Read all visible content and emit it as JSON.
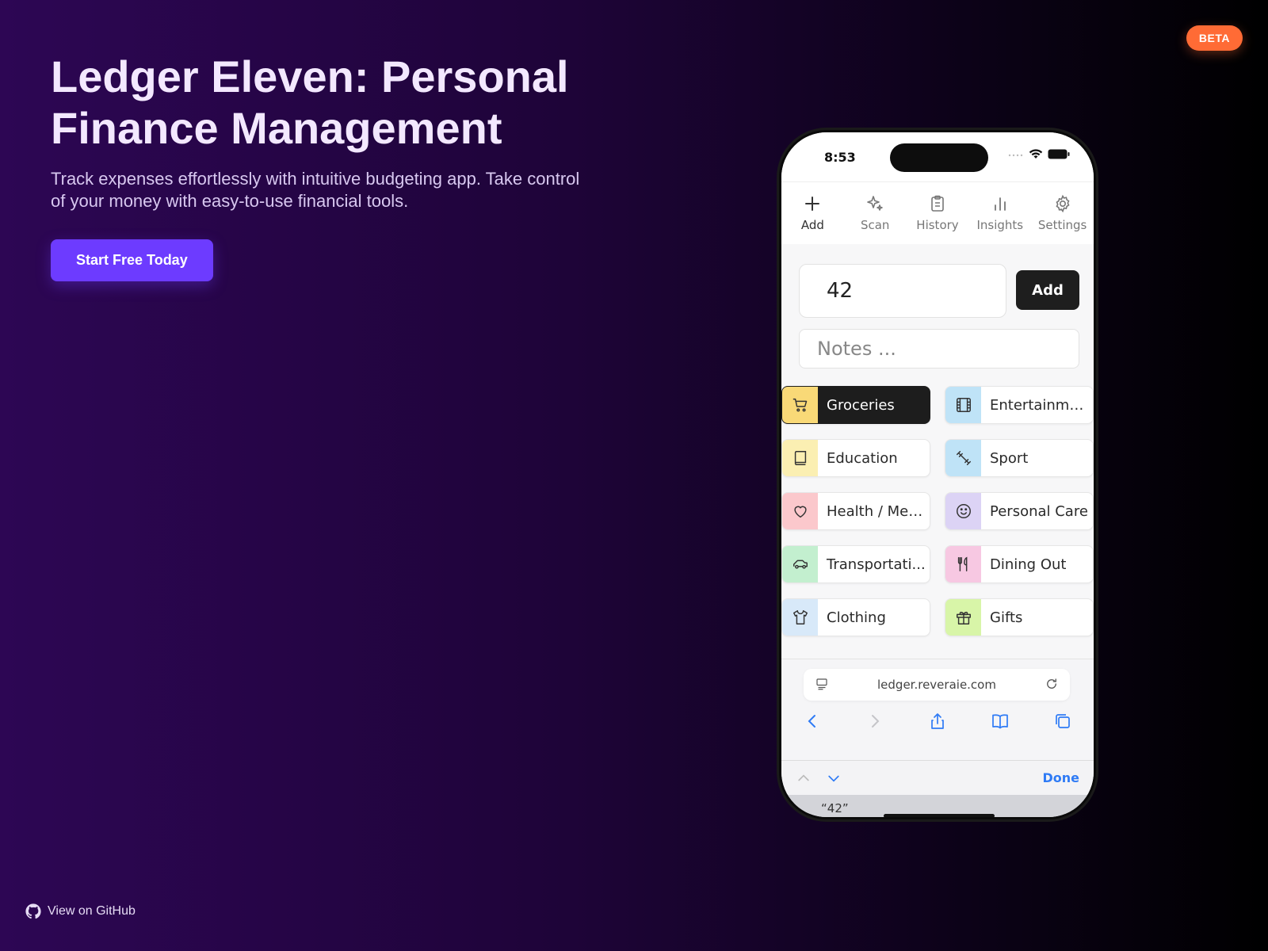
{
  "badge": "BETA",
  "hero": {
    "title": "Ledger Eleven: Personal Finance Management",
    "subtitle": "Track expenses effortlessly with intuitive budgeting app. Take control of your money with easy-to-use financial tools.",
    "cta_label": "Start Free Today"
  },
  "footer": {
    "github_label": "View on GitHub"
  },
  "colors": {
    "accent": "#6d3bff",
    "badge": "#ff6b35"
  },
  "phone": {
    "time": "8:53",
    "toolbar": [
      {
        "label": "Add",
        "icon": "plus-icon"
      },
      {
        "label": "Scan",
        "icon": "sparkle-icon"
      },
      {
        "label": "History",
        "icon": "clipboard-icon"
      },
      {
        "label": "Insights",
        "icon": "bar-chart-icon"
      },
      {
        "label": "Settings",
        "icon": "gear-icon"
      }
    ],
    "amount_value": "42",
    "add_button": "Add",
    "notes_placeholder": "Notes ...",
    "categories": [
      {
        "label": "Groceries",
        "icon": "cart-icon",
        "color": "#f9d977",
        "selected": true
      },
      {
        "label": "Entertainment",
        "icon": "film-icon",
        "color": "#bfe3f7"
      },
      {
        "label": "Education",
        "icon": "book-icon",
        "color": "#fbefb2"
      },
      {
        "label": "Sport",
        "icon": "dumbbell-icon",
        "color": "#bfe3f7"
      },
      {
        "label": "Health / Med...",
        "icon": "heart-icon",
        "color": "#fbc8cc"
      },
      {
        "label": "Personal Care",
        "icon": "smile-icon",
        "color": "#dcd3f5"
      },
      {
        "label": "Transportati...",
        "icon": "car-icon",
        "color": "#c3efcf"
      },
      {
        "label": "Dining Out",
        "icon": "utensils-icon",
        "color": "#f7c8e2"
      },
      {
        "label": "Clothing",
        "icon": "shirt-icon",
        "color": "#d8e9f9"
      },
      {
        "label": "Gifts",
        "icon": "gift-icon",
        "color": "#d8f5a8"
      }
    ],
    "url": "ledger.reveraie.com",
    "keyboard_done": "Done",
    "suggestion": "“42”"
  }
}
